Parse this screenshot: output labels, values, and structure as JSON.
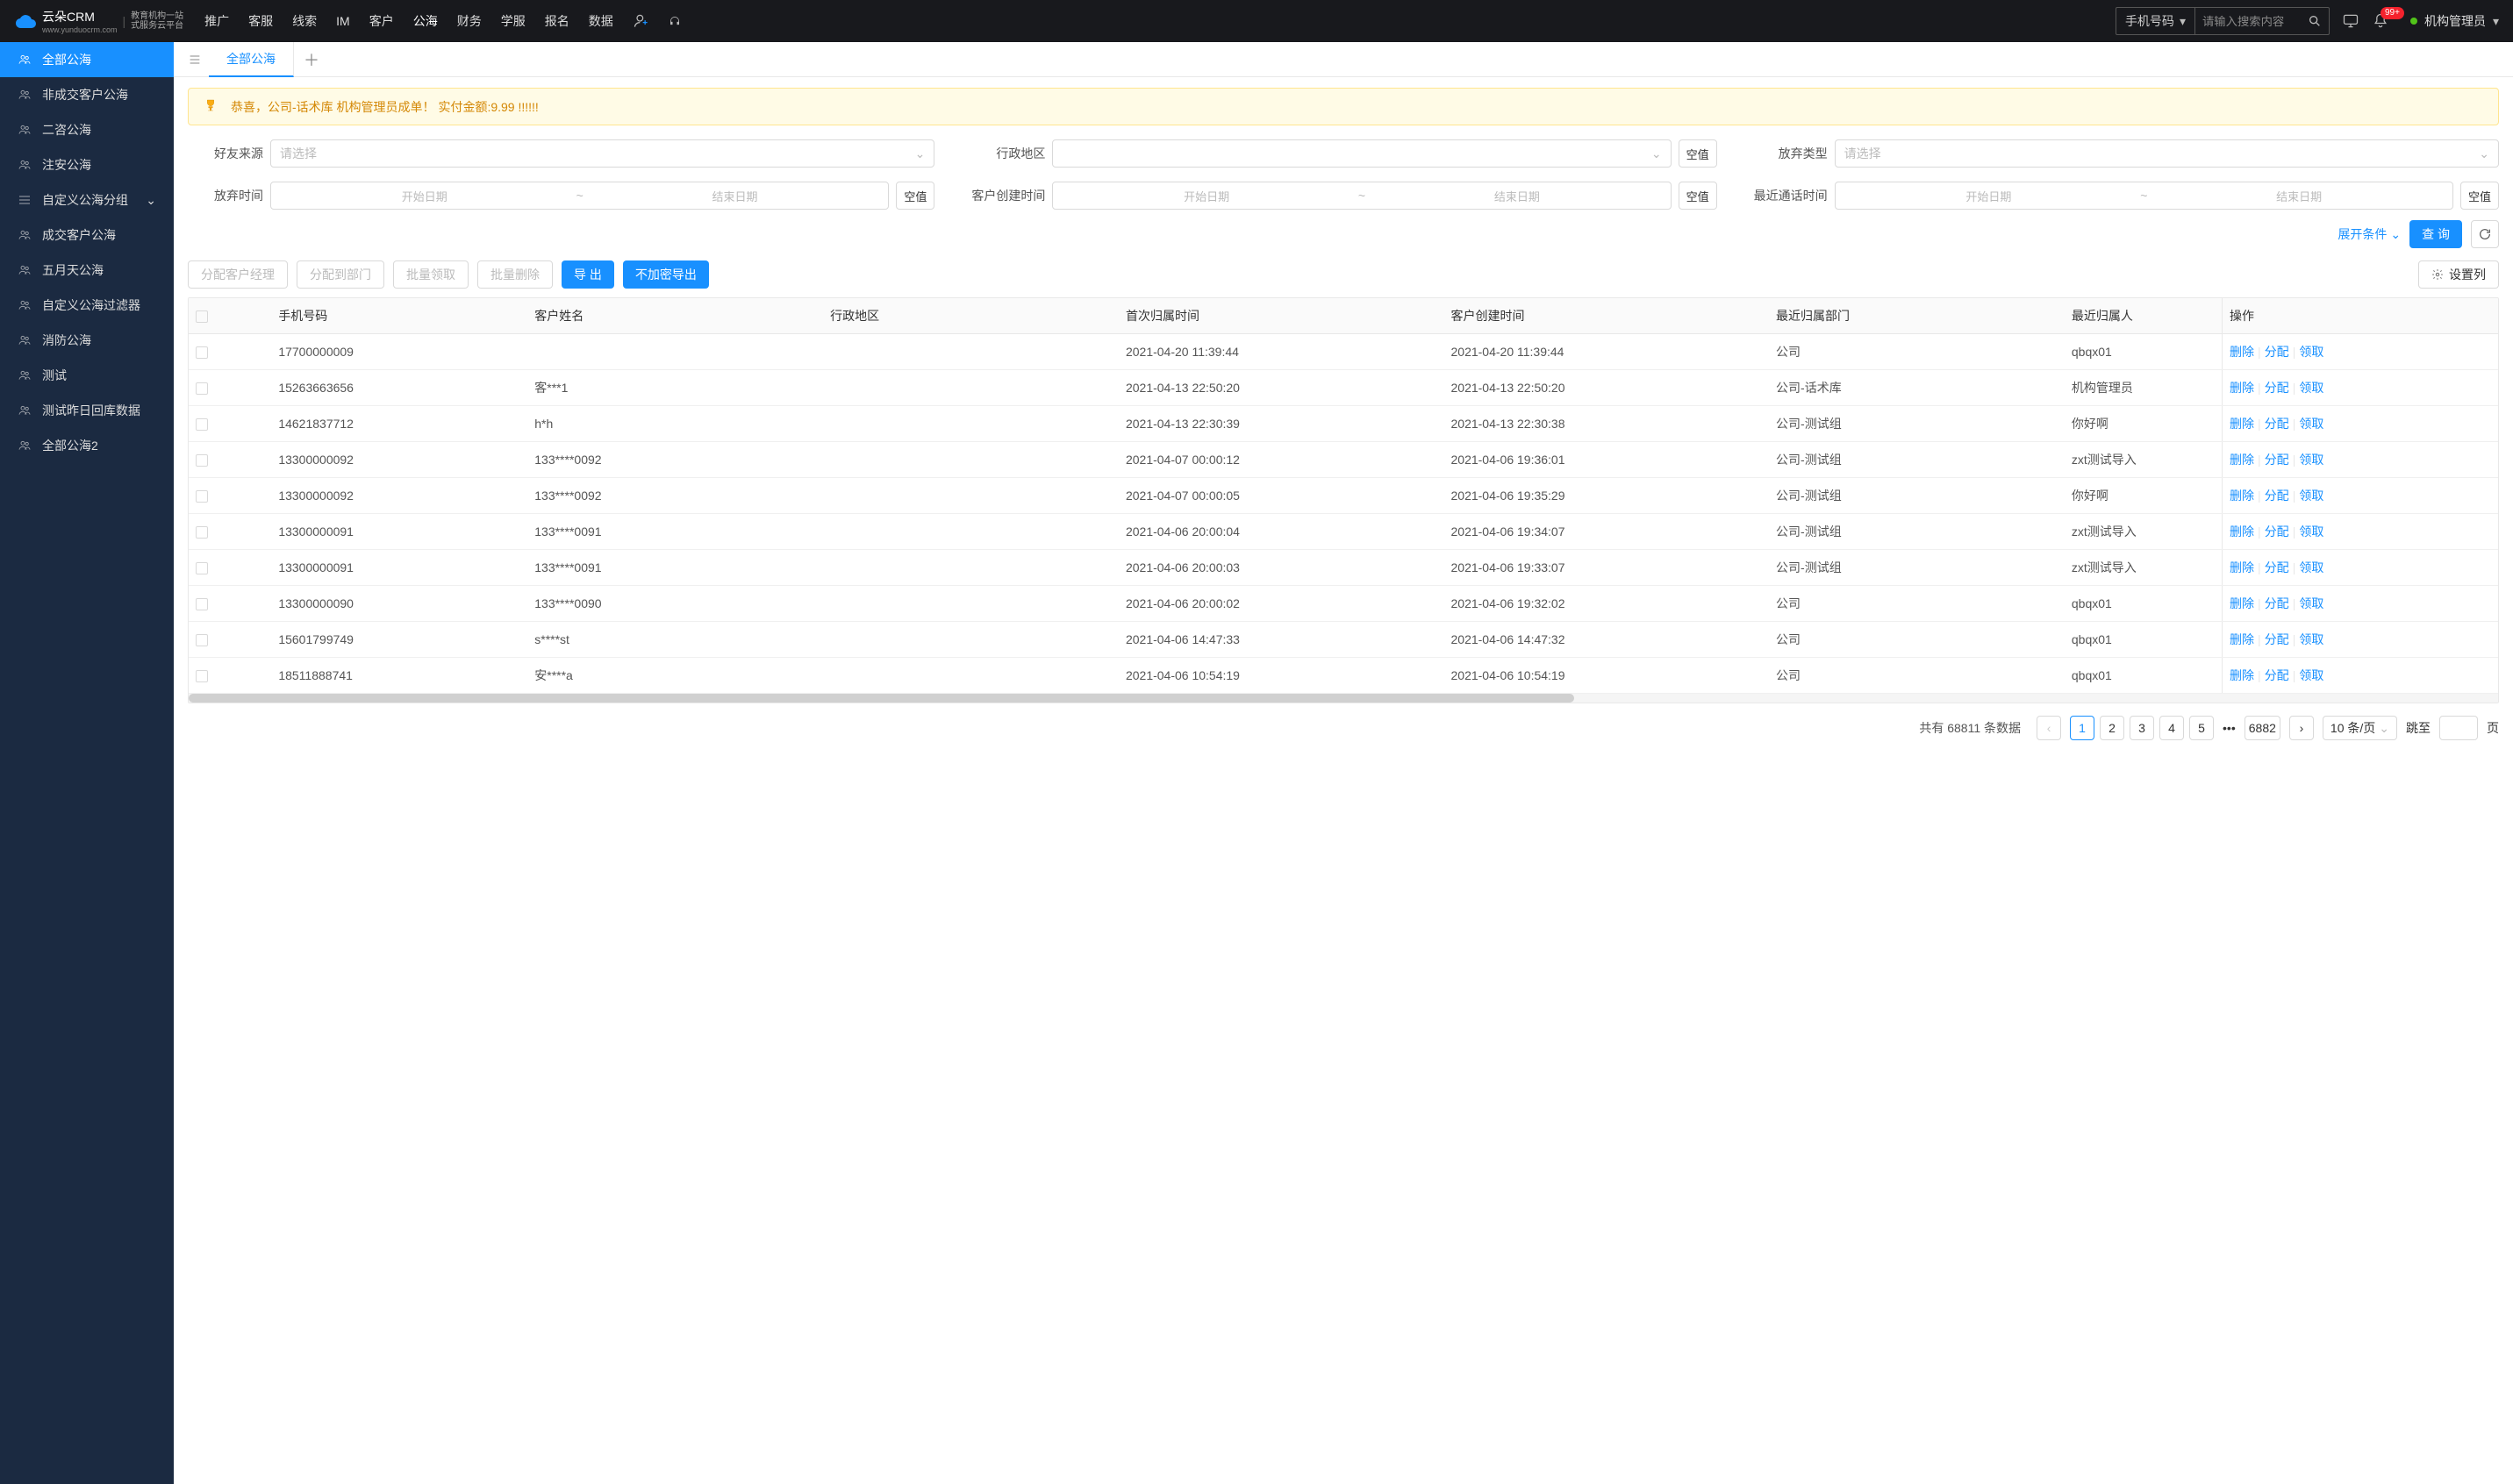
{
  "logo": {
    "brand": "云朵CRM",
    "sub_line1": "教育机构一站",
    "sub_line2": "式服务云平台",
    "domain": "www.yunduocrm.com"
  },
  "nav": {
    "items": [
      "推广",
      "客服",
      "线索",
      "IM",
      "客户",
      "公海",
      "财务",
      "学服",
      "报名",
      "数据"
    ],
    "active_index": 5
  },
  "header": {
    "search_type": "手机号码",
    "search_placeholder": "请输入搜索内容",
    "badge": "99+",
    "user_name": "机构管理员"
  },
  "sidebar": {
    "items": [
      {
        "label": "全部公海",
        "icon": "users",
        "active": true
      },
      {
        "label": "非成交客户公海",
        "icon": "users"
      },
      {
        "label": "二咨公海",
        "icon": "users"
      },
      {
        "label": "注安公海",
        "icon": "users"
      },
      {
        "label": "自定义公海分组",
        "icon": "stack",
        "has_children": true
      },
      {
        "label": "成交客户公海",
        "icon": "users"
      },
      {
        "label": "五月天公海",
        "icon": "users"
      },
      {
        "label": "自定义公海过滤器",
        "icon": "users"
      },
      {
        "label": "消防公海",
        "icon": "users"
      },
      {
        "label": "测试",
        "icon": "users"
      },
      {
        "label": "测试昨日回库数据",
        "icon": "users"
      },
      {
        "label": "全部公海2",
        "icon": "users"
      }
    ]
  },
  "tabs": {
    "items": [
      "全部公海"
    ],
    "active_index": 0
  },
  "alert": {
    "text": "恭喜，公司-话术库  机构管理员成单！  实付金额:9.99 !!!!!!"
  },
  "filters": {
    "source_label": "好友来源",
    "region_label": "行政地区",
    "abandon_type_label": "放弃类型",
    "abandon_time_label": "放弃时间",
    "create_time_label": "客户创建时间",
    "last_call_label": "最近通话时间",
    "select_placeholder": "请选择",
    "start_placeholder": "开始日期",
    "end_placeholder": "结束日期",
    "empty_btn": "空值",
    "expand": "展开条件",
    "query": "查 询"
  },
  "actions": {
    "assign_manager": "分配客户经理",
    "assign_dept": "分配到部门",
    "batch_claim": "批量领取",
    "batch_delete": "批量删除",
    "export": "导 出",
    "export_plain": "不加密导出",
    "set_columns": "设置列"
  },
  "table": {
    "headers": {
      "phone": "手机号码",
      "name": "客户姓名",
      "region": "行政地区",
      "first_own_time": "首次归属时间",
      "create_time": "客户创建时间",
      "last_dept": "最近归属部门",
      "last_person": "最近归属人",
      "ops": "操作"
    },
    "op_labels": {
      "delete": "删除",
      "assign": "分配",
      "claim": "领取"
    },
    "rows": [
      {
        "phone": "17700000009",
        "name": "",
        "region": "",
        "first": "2021-04-20 11:39:44",
        "create": "2021-04-20 11:39:44",
        "dept": "公司",
        "person": "qbqx01"
      },
      {
        "phone": "15263663656",
        "name": "客***1",
        "region": "",
        "first": "2021-04-13 22:50:20",
        "create": "2021-04-13 22:50:20",
        "dept": "公司-话术库",
        "person": "机构管理员"
      },
      {
        "phone": "14621837712",
        "name": "h*h",
        "region": "",
        "first": "2021-04-13 22:30:39",
        "create": "2021-04-13 22:30:38",
        "dept": "公司-测试组",
        "person": "你好啊"
      },
      {
        "phone": "13300000092",
        "name": "133****0092",
        "region": "",
        "first": "2021-04-07 00:00:12",
        "create": "2021-04-06 19:36:01",
        "dept": "公司-测试组",
        "person": "zxt测试导入"
      },
      {
        "phone": "13300000092",
        "name": "133****0092",
        "region": "",
        "first": "2021-04-07 00:00:05",
        "create": "2021-04-06 19:35:29",
        "dept": "公司-测试组",
        "person": "你好啊"
      },
      {
        "phone": "13300000091",
        "name": "133****0091",
        "region": "",
        "first": "2021-04-06 20:00:04",
        "create": "2021-04-06 19:34:07",
        "dept": "公司-测试组",
        "person": "zxt测试导入"
      },
      {
        "phone": "13300000091",
        "name": "133****0091",
        "region": "",
        "first": "2021-04-06 20:00:03",
        "create": "2021-04-06 19:33:07",
        "dept": "公司-测试组",
        "person": "zxt测试导入"
      },
      {
        "phone": "13300000090",
        "name": "133****0090",
        "region": "",
        "first": "2021-04-06 20:00:02",
        "create": "2021-04-06 19:32:02",
        "dept": "公司",
        "person": "qbqx01"
      },
      {
        "phone": "15601799749",
        "name": "s****st",
        "region": "",
        "first": "2021-04-06 14:47:33",
        "create": "2021-04-06 14:47:32",
        "dept": "公司",
        "person": "qbqx01"
      },
      {
        "phone": "18511888741",
        "name": "安****a",
        "region": "",
        "first": "2021-04-06 10:54:19",
        "create": "2021-04-06 10:54:19",
        "dept": "公司",
        "person": "qbqx01"
      }
    ]
  },
  "pagination": {
    "total_prefix": "共有",
    "total": "68811",
    "total_suffix": "条数据",
    "pages": [
      "1",
      "2",
      "3",
      "4",
      "5"
    ],
    "last_page": "6882",
    "per_page": "10 条/页",
    "jump_label": "跳至",
    "page_suffix": "页"
  }
}
